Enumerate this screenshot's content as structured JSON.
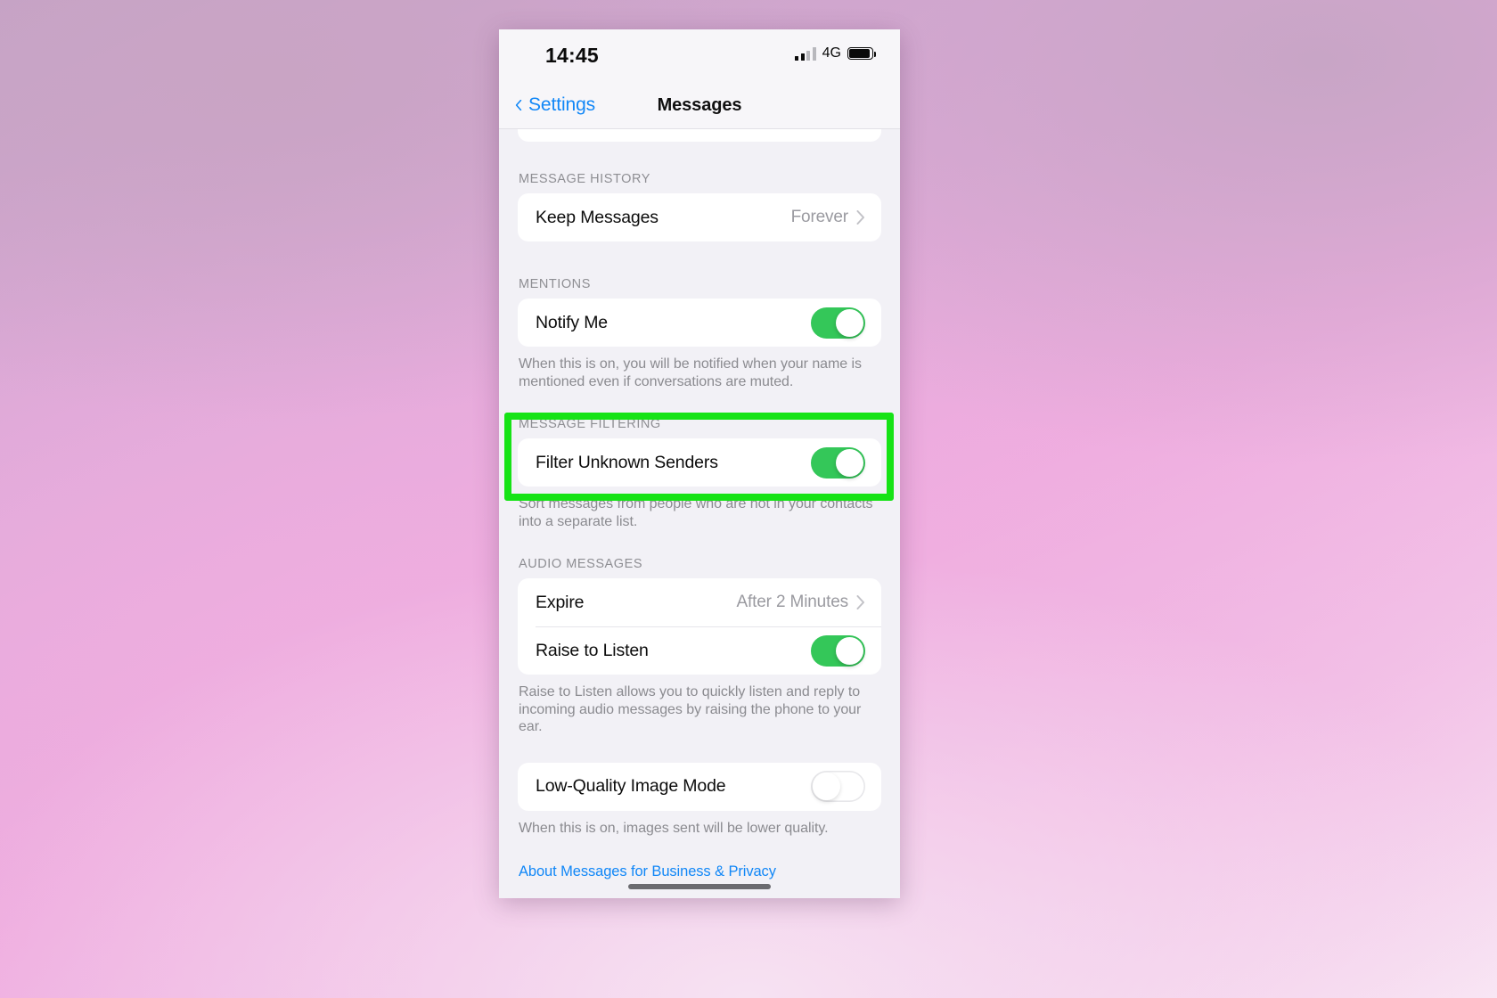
{
  "status_bar": {
    "time": "14:45",
    "network": "4G",
    "signal_icon": "cellular-signal-icon",
    "battery_icon": "battery-icon"
  },
  "nav": {
    "back_label": "Settings",
    "back_icon": "chevron-left-icon",
    "title": "Messages"
  },
  "sections": {
    "message_history": {
      "header": "MESSAGE HISTORY",
      "keep_messages_label": "Keep Messages",
      "keep_messages_value": "Forever"
    },
    "mentions": {
      "header": "MENTIONS",
      "notify_me_label": "Notify Me",
      "notify_me_state": "on",
      "footer": "When this is on, you will be notified when your name is mentioned even if conversations are muted."
    },
    "message_filtering": {
      "header": "MESSAGE FILTERING",
      "filter_unknown_senders_label": "Filter Unknown Senders",
      "filter_unknown_senders_state": "on",
      "footer": "Sort messages from people who are not in your contacts into a separate list."
    },
    "audio_messages": {
      "header": "AUDIO MESSAGES",
      "expire_label": "Expire",
      "expire_value": "After 2 Minutes",
      "raise_to_listen_label": "Raise to Listen",
      "raise_to_listen_state": "on",
      "footer": "Raise to Listen allows you to quickly listen and reply to incoming audio messages by raising the phone to your ear."
    },
    "image_mode": {
      "low_quality_image_mode_label": "Low-Quality Image Mode",
      "low_quality_image_mode_state": "off",
      "footer": "When this is on, images sent will be lower quality."
    },
    "about_link": "About Messages for Business & Privacy"
  },
  "annotation": {
    "highlight_color": "#16e316",
    "highlight_target": "Filter Unknown Senders"
  },
  "colors": {
    "accent_blue": "#1187f7",
    "toggle_on_green": "#34c759",
    "page_background": "#f2f1f6"
  }
}
